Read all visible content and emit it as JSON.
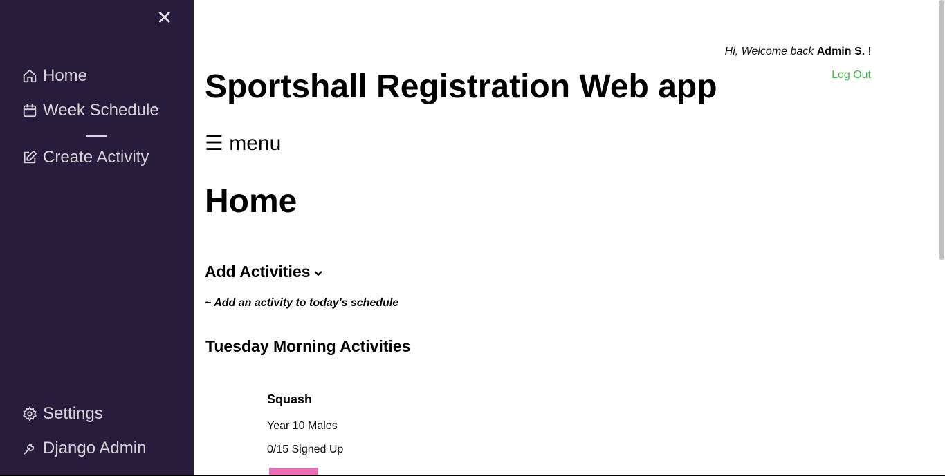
{
  "sidebar": {
    "close_icon": "close-icon",
    "items": [
      {
        "label": "Home",
        "icon": "home-icon"
      },
      {
        "label": "Week Schedule",
        "icon": "calendar-icon"
      },
      {
        "label": "Create Activity",
        "icon": "edit-icon"
      }
    ],
    "bottom_items": [
      {
        "label": "Settings",
        "icon": "gear-icon"
      },
      {
        "label": "Django Admin",
        "icon": "wrench-icon"
      }
    ],
    "background_color": "#271c3b"
  },
  "header": {
    "welcome_prefix": "Hi, Welcome back",
    "user_name": "Admin S.",
    "welcome_suffix": "!",
    "logout_label": "Log Out",
    "app_title": "Sportshall Registration Web app",
    "menu_toggle": "☰ menu"
  },
  "main": {
    "page_title": "Home",
    "add_activities_label": "Add Activities",
    "add_activities_subtitle": "~ Add an activity to today's schedule",
    "section_title": "Tuesday Morning Activities",
    "activities": [
      {
        "name": "Squash",
        "group": "Year 10 Males",
        "signups": "0/15 Signed Up"
      }
    ]
  },
  "colors": {
    "accent_green": "#4caf50",
    "accent_pink": "#f06aba"
  }
}
